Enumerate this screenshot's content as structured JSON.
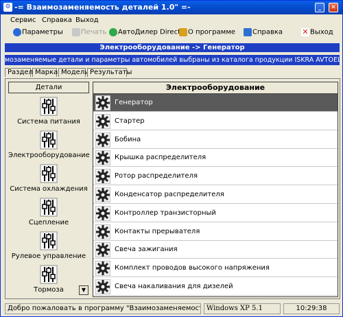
{
  "window": {
    "title": "-= Взаимозаменяемость деталей 1.0\" =-"
  },
  "menu": {
    "items": [
      "Сервис",
      "Справка",
      "Выход"
    ]
  },
  "toolbar": {
    "params": "Параметры",
    "print": "Печать",
    "autodealer": "АвтоДилер Direct",
    "about": "О программе",
    "help": "Справка",
    "exit": "Выход"
  },
  "path": "Электрооборудование -> Генератор",
  "ticker": "мозаменяемые детали и параметры автомобилей выбраны из каталога продукции ISKRA AVTOELECTRIKA (Слове",
  "tabs": [
    "Раздел",
    "Марка",
    "Модель",
    "Результаты"
  ],
  "left": {
    "header": "Детали",
    "items": [
      "Система питания",
      "Электрооборудование",
      "Система охлаждения",
      "Сцепление",
      "Рулевое управление",
      "Тормоза"
    ]
  },
  "right": {
    "header": "Электрооборудование",
    "selected_index": 0,
    "items": [
      "Генератор",
      "Стартер",
      "Бобина",
      "Крышка распределителя",
      "Ротор распределителя",
      "Конденсатор распределителя",
      "Контроллер транзисторный",
      "Контакты прерывателя",
      "Свеча зажигания",
      "Комплект проводов  высокого напряжения",
      "Свеча накаливания для дизелей"
    ]
  },
  "status": {
    "message": "Добро пожаловать в программу \"Взаимозаменяемость деталей\"",
    "os": "Windows XP  5.1",
    "time": "10:29:38"
  },
  "colors": {
    "titlebar": "#0548c8",
    "path_bar": "#1e3fc4",
    "selected_row": "#5a5a5a"
  }
}
